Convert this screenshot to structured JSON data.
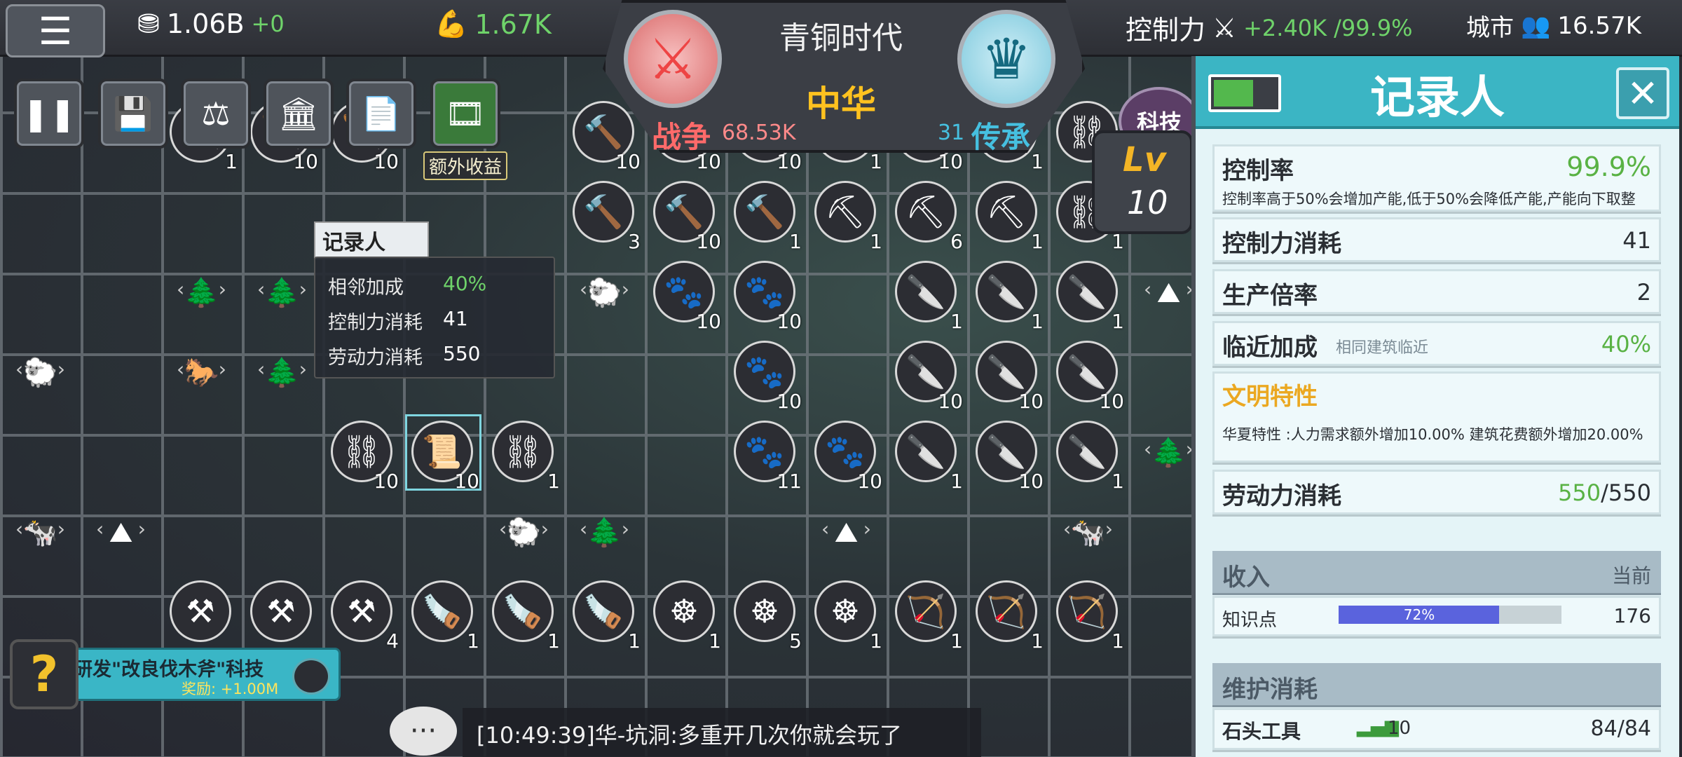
{
  "topbar": {
    "gold": "1.06B",
    "gold_delta": "+0",
    "power": "1.67K",
    "control_label": "控制力",
    "control_delta": "+2.40K",
    "control_pct": "/99.9%",
    "city_label": "城市",
    "city_pop": "16.57K"
  },
  "badge": {
    "era": "青铜时代",
    "nation": "中华",
    "war_label": "战争",
    "war_value": "68.53K",
    "inherit_num": "31",
    "inherit_label": "传承"
  },
  "toolbar": {
    "extra_income": "额外收益"
  },
  "tooltip": {
    "title": "记录人",
    "rows": [
      {
        "k": "相邻加成",
        "v": "40%"
      },
      {
        "k": "控制力消耗",
        "v": "41"
      },
      {
        "k": "劳动力消耗",
        "v": "550"
      }
    ]
  },
  "tech": {
    "label": "科技",
    "lv_label": "Lv",
    "lv": "10"
  },
  "panel": {
    "title": "记录人",
    "control_rate_label": "控制率",
    "control_rate_value": "99.9%",
    "control_rate_desc": "控制率高于50%会增加产能,低于50%会降低产能,产能向下取整",
    "control_cost_label": "控制力消耗",
    "control_cost_value": "41",
    "prod_mult_label": "生产倍率",
    "prod_mult_value": "2",
    "adj_label": "临近加成",
    "adj_hint": "相同建筑临近",
    "adj_value": "40%",
    "trait_label": "文明特性",
    "trait_desc": "华夏特性 :人力需求额外增加10.00% 建筑花费额外增加20.00%",
    "labor_label": "劳动力消耗",
    "labor_used": "550",
    "labor_total": "/550",
    "income_label": "收入",
    "income_current": "当前",
    "knowledge_label": "知识点",
    "knowledge_progress": "72%",
    "knowledge_value": "176",
    "upkeep_label": "维护消耗",
    "stone_label": "石头工具",
    "stone_count": "10",
    "stone_value": "84/84"
  },
  "quest": {
    "text": "研发\"改良伐木斧\"科技",
    "reward": "奖励: +1.00M"
  },
  "chat": {
    "message": "[10:49:39]华-坑洞:多重开几次你就会玩了"
  },
  "colors": {
    "accent": "#3bb5c4",
    "green": "#6fd36a",
    "gold": "#ffc21f",
    "war": "#ff6a6a"
  }
}
